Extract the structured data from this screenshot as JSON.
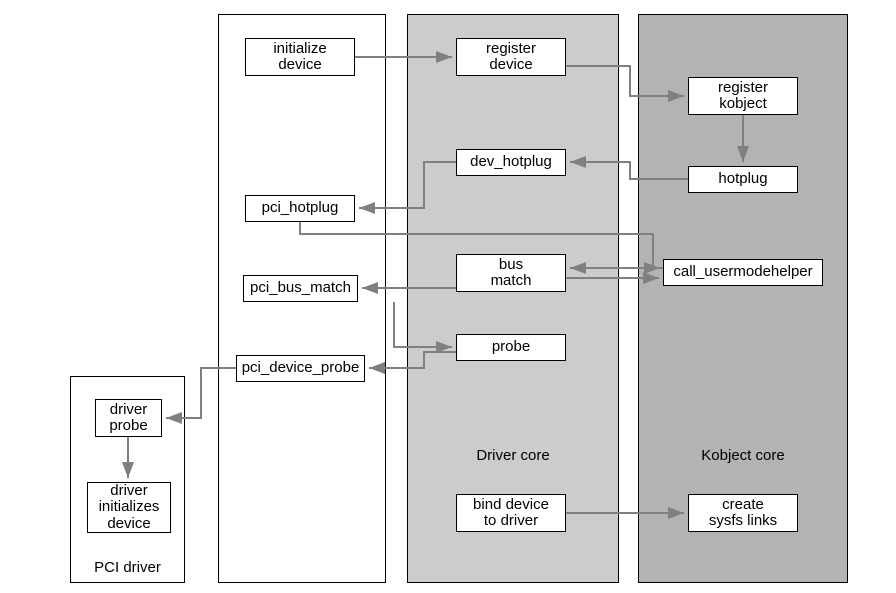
{
  "columns": {
    "pci_driver": {
      "label": "PCI driver"
    },
    "driver_core": {
      "label": "Driver core"
    },
    "kobject_core": {
      "label": "Kobject core"
    }
  },
  "nodes": {
    "initialize_device": {
      "label": "initialize\ndevice"
    },
    "register_device": {
      "label": "register\ndevice"
    },
    "register_kobject": {
      "label": "register\nkobject"
    },
    "dev_hotplug": {
      "label": "dev_hotplug"
    },
    "hotplug": {
      "label": "hotplug"
    },
    "pci_hotplug": {
      "label": "pci_hotplug"
    },
    "bus_match": {
      "label": "bus\nmatch"
    },
    "call_usermodehelper": {
      "label": "call_usermodehelper"
    },
    "pci_bus_match": {
      "label": "pci_bus_match"
    },
    "probe": {
      "label": "probe"
    },
    "pci_device_probe": {
      "label": "pci_device_probe"
    },
    "driver_probe": {
      "label": "driver\nprobe"
    },
    "driver_init_device": {
      "label": "driver\ninitializes\ndevice"
    },
    "bind_device": {
      "label": "bind device\nto driver"
    },
    "create_sysfs": {
      "label": "create\nsysfs links"
    }
  },
  "edges": [
    {
      "from": "initialize_device",
      "to": "register_device"
    },
    {
      "from": "register_device",
      "to": "register_kobject"
    },
    {
      "from": "register_kobject",
      "to": "hotplug"
    },
    {
      "from": "hotplug",
      "to": "dev_hotplug"
    },
    {
      "from": "dev_hotplug",
      "to": "pci_hotplug"
    },
    {
      "from": "pci_hotplug",
      "to": "call_usermodehelper",
      "note": "routed"
    },
    {
      "from": "call_usermodehelper",
      "to": "bus_match",
      "bidir": true
    },
    {
      "from": "bus_match",
      "to": "pci_bus_match"
    },
    {
      "from": "pci_bus_match",
      "to": "probe",
      "note": "routed"
    },
    {
      "from": "probe",
      "to": "pci_device_probe"
    },
    {
      "from": "pci_device_probe",
      "to": "driver_probe",
      "note": "routed"
    },
    {
      "from": "driver_probe",
      "to": "driver_init_device"
    },
    {
      "from": "bind_device",
      "to": "create_sysfs"
    }
  ]
}
